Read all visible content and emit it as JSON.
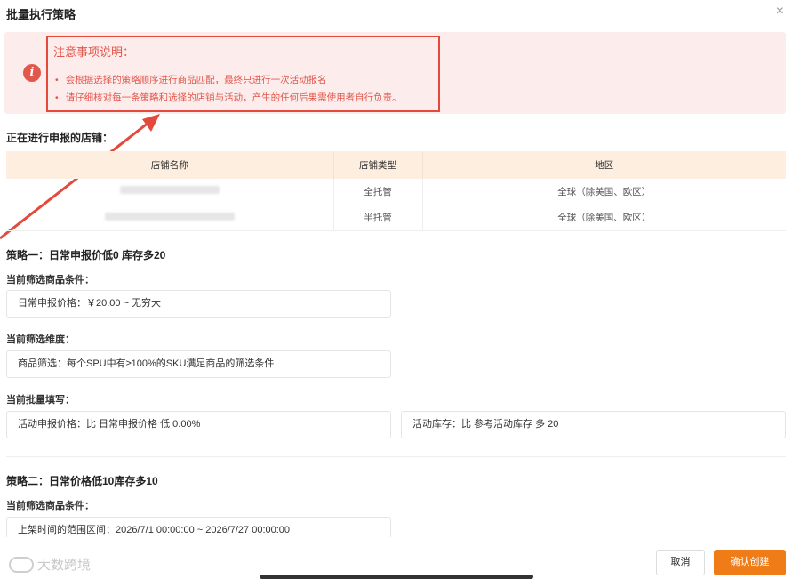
{
  "modal": {
    "title": "批量执行策略",
    "close_symbol": "×"
  },
  "notice": {
    "title": "注意事项说明：",
    "items": [
      "会根据选择的策略顺序进行商品匹配，最终只进行一次活动报名",
      "请仔细核对每一条策略和选择的店铺与活动，产生的任何后果需使用者自行负责。"
    ],
    "accent_color": "#e2574c"
  },
  "shops": {
    "section_title": "正在进行申报的店铺：",
    "columns": [
      "店铺名称",
      "店铺类型",
      "地区"
    ],
    "rows": [
      {
        "name": "",
        "type": "全托管",
        "region": "全球（除美国、欧区）"
      },
      {
        "name": "",
        "type": "半托管",
        "region": "全球（除美国、欧区）"
      }
    ]
  },
  "strategy1": {
    "title": "策略一：日常申报价低0 库存多20",
    "condition_label": "当前筛选商品条件：",
    "condition_value": "日常申报价格：￥20.00 ~ 无穷大",
    "dimension_label": "当前筛选维度：",
    "dimension_value": "商品筛选：每个SPU中有≥100%的SKU满足商品的筛选条件",
    "batch_label": "当前批量填写：",
    "batch_price": "活动申报价格：比 日常申报价格 低 0.00%",
    "batch_stock": "活动库存：比 参考活动库存 多 20"
  },
  "strategy2": {
    "title": "策略二：日常价格低10库存多10",
    "condition_label": "当前筛选商品条件：",
    "condition_value": "上架时间的范围区间：2026/7/1 00:00:00 ~ 2026/7/27 00:00:00"
  },
  "footer": {
    "watermark": "大数跨境",
    "cancel_label": "取消",
    "confirm_label": "确认创建",
    "confirm_color": "#f07c18"
  }
}
